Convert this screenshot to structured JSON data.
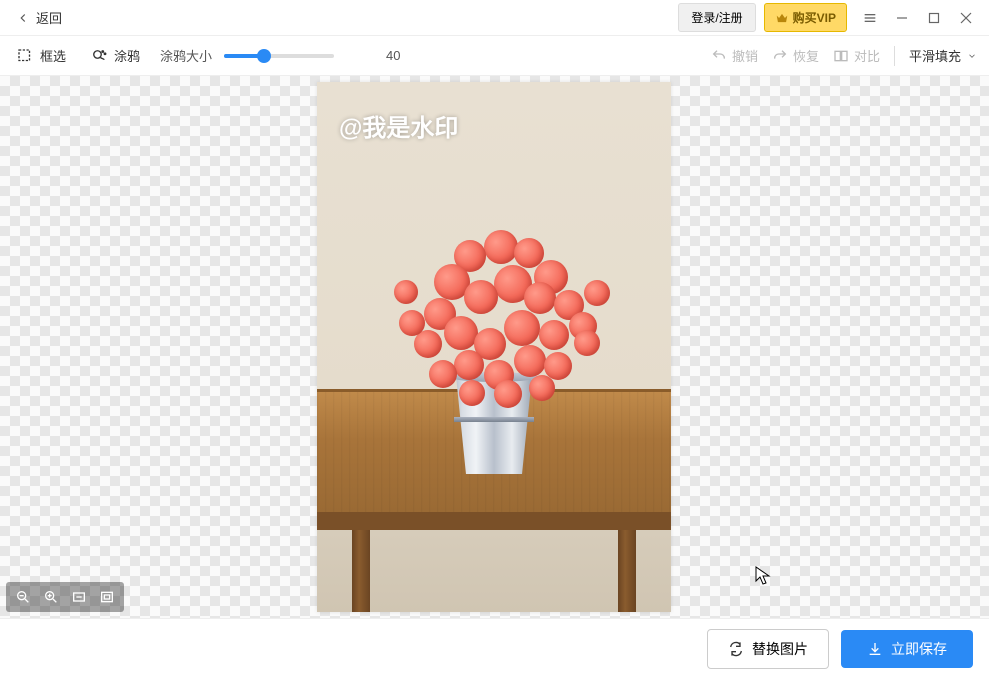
{
  "titlebar": {
    "back_label": "返回",
    "login_label": "登录/注册",
    "vip_label": "购买VIP"
  },
  "toolbar": {
    "box_select_label": "框选",
    "brush_label": "涂鸦",
    "slider_label": "涂鸦大小",
    "slider_value": "40",
    "undo_label": "撤销",
    "redo_label": "恢复",
    "compare_label": "对比",
    "fill_mode_label": "平滑填充"
  },
  "image": {
    "watermark_text": "@我是水印"
  },
  "footer": {
    "replace_label": "替换图片",
    "save_label": "立即保存"
  }
}
